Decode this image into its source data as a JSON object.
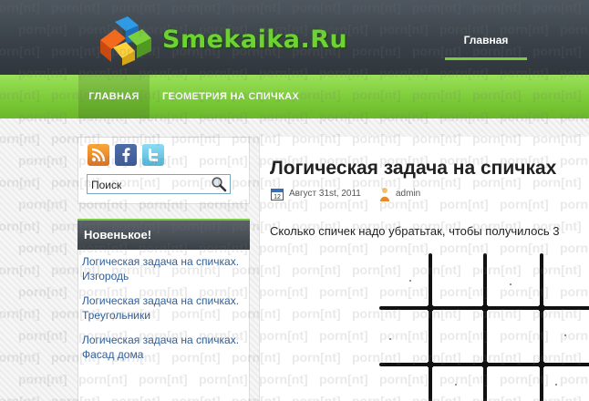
{
  "header": {
    "logo_text": "Smekaika.Ru",
    "top_nav": [
      "Главная"
    ]
  },
  "main_nav": {
    "items": [
      "ГЛАВНАЯ",
      "ГЕОМЕТРИЯ НА СПИЧКАХ"
    ]
  },
  "sidebar": {
    "social_icons": [
      "rss-icon",
      "facebook-icon",
      "twitter-icon"
    ],
    "search": {
      "placeholder": "Поиск",
      "value": "Поиск"
    },
    "widget": {
      "title": "Новенькое!",
      "links": [
        [
          "Логическая задача на спичках.",
          "Изгородь"
        ],
        [
          "Логическая задача на спичках.",
          "Треугольники"
        ],
        [
          "Логическая задача на спичках.",
          "Фасад дома"
        ]
      ]
    }
  },
  "post": {
    "title": "Логическая задача на спичках",
    "date": "Август 31st, 2011",
    "author": "admin",
    "text": "Сколько спичек надо убратьтак, чтобы получилось 3"
  },
  "watermark": "porn[nt]",
  "colors": {
    "header_dark": "#394047",
    "accent_green": "#7ccb3a",
    "link_blue": "#2e5f9a"
  }
}
